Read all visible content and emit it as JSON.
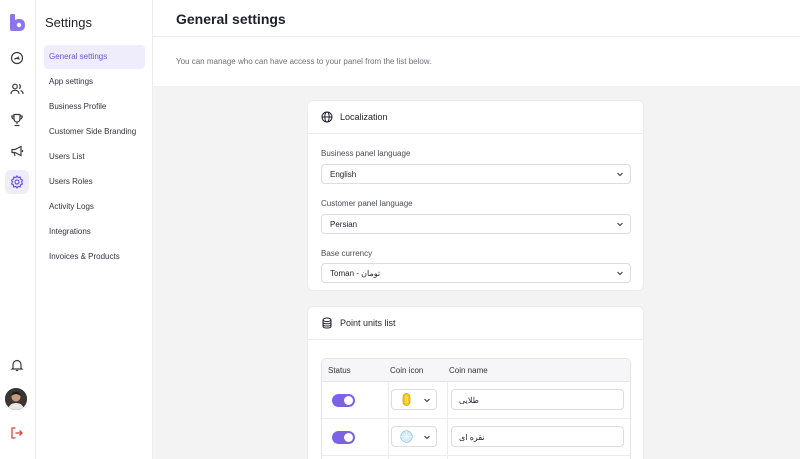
{
  "sidebar": {
    "title": "Settings",
    "items": [
      {
        "label": "General settings"
      },
      {
        "label": "App settings"
      },
      {
        "label": "Business Profile"
      },
      {
        "label": "Customer Side Branding"
      },
      {
        "label": "Users List"
      },
      {
        "label": "Users Roles"
      },
      {
        "label": "Activity Logs"
      },
      {
        "label": "Integrations"
      },
      {
        "label": "Invoices & Products"
      }
    ]
  },
  "rail": {
    "icons": [
      "logo-icon",
      "dashboard-icon",
      "users-icon",
      "trophy-icon",
      "megaphone-icon",
      "gear-icon",
      "bell-icon",
      "avatar",
      "logout-icon"
    ],
    "accent": "#7c63e6",
    "logout_color": "#e0413c"
  },
  "header": {
    "title": "General settings",
    "subtitle": "You can manage who can have access to your panel from the list below."
  },
  "localization": {
    "title": "Localization",
    "business_language_label": "Business panel language",
    "business_language_value": "English",
    "customer_language_label": "Customer panel language",
    "customer_language_value": "Persian",
    "currency_label": "Base currency",
    "currency_value": "Toman - تومان"
  },
  "point_units": {
    "title": "Point units list",
    "columns": [
      "Status",
      "Coin icon",
      "Coin name"
    ],
    "rows": [
      {
        "status": "on",
        "coin_icon": "gold-coin-icon",
        "coin_name": "طلایی"
      },
      {
        "status": "on",
        "coin_icon": "silver-coin-icon",
        "coin_name": "نقره ای"
      }
    ]
  }
}
